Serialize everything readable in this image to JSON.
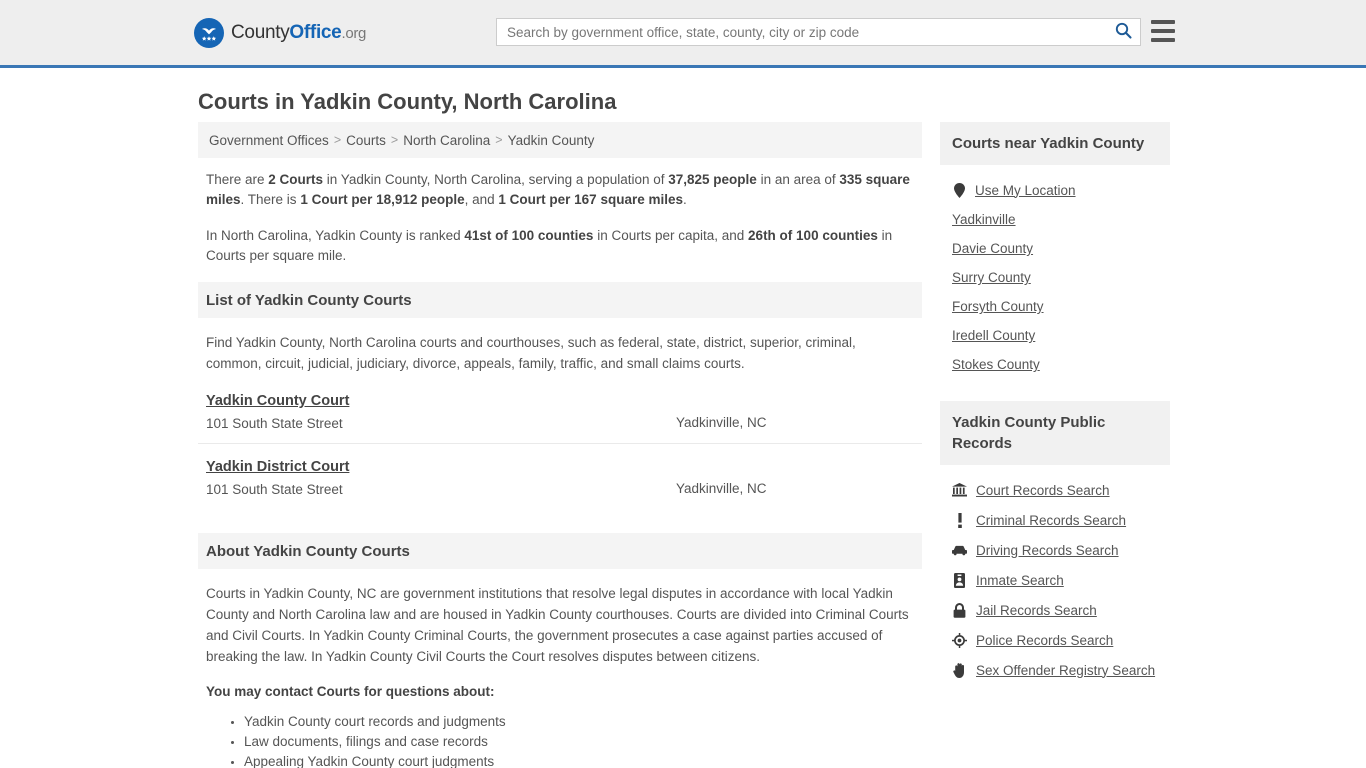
{
  "header": {
    "logo": {
      "icon": "eagle-shield-logo-icon",
      "text_county": "County",
      "text_office": "Office",
      "text_org": ".org"
    },
    "search": {
      "placeholder": "Search by government office, state, county, city or zip code",
      "value": "",
      "icon": "search-icon",
      "accent": "#1565b5"
    },
    "menu": {
      "icon": "hamburger-menu-icon"
    },
    "border_color": "#3a77b5",
    "background": "#eeeeee"
  },
  "page": {
    "title": "Courts in Yadkin County, North Carolina"
  },
  "breadcrumb": {
    "separator": ">",
    "items": [
      {
        "label": "Government Offices"
      },
      {
        "label": "Courts"
      },
      {
        "label": "North Carolina"
      },
      {
        "label": "Yadkin County"
      }
    ]
  },
  "intro": {
    "paragraph1": {
      "parts": [
        {
          "text": "There are ",
          "bold": false
        },
        {
          "text": "2 Courts",
          "bold": true
        },
        {
          "text": " in Yadkin County, North Carolina, serving a population of ",
          "bold": false
        },
        {
          "text": "37,825 people",
          "bold": true
        },
        {
          "text": " in an area of ",
          "bold": false
        },
        {
          "text": "335 square miles",
          "bold": true
        },
        {
          "text": ". There is ",
          "bold": false
        },
        {
          "text": "1 Court per 18,912 people",
          "bold": true
        },
        {
          "text": ", and ",
          "bold": false
        },
        {
          "text": "1 Court per 167 square miles",
          "bold": true
        },
        {
          "text": ".",
          "bold": false
        }
      ]
    },
    "paragraph2": {
      "parts": [
        {
          "text": "In North Carolina, Yadkin County is ranked ",
          "bold": false
        },
        {
          "text": "41st of 100 counties",
          "bold": true
        },
        {
          "text": " in Courts per capita, and ",
          "bold": false
        },
        {
          "text": "26th of 100 counties",
          "bold": true
        },
        {
          "text": " in Courts per square mile.",
          "bold": false
        }
      ]
    }
  },
  "list_section": {
    "heading": "List of Yadkin County Courts",
    "description": "Find Yadkin County, North Carolina courts and courthouses, such as federal, state, district, superior, criminal, common, circuit, judicial, judiciary, divorce, appeals, family, traffic, and small claims courts.",
    "courts": [
      {
        "name": "Yadkin County Court",
        "address": "101 South State Street",
        "city": "Yadkinville, NC"
      },
      {
        "name": "Yadkin District Court",
        "address": "101 South State Street",
        "city": "Yadkinville, NC"
      }
    ]
  },
  "about_section": {
    "heading": "About Yadkin County Courts",
    "body": "Courts in Yadkin County, NC are government institutions that resolve legal disputes in accordance with local Yadkin County and North Carolina law and are housed in Yadkin County courthouses. Courts are divided into Criminal Courts and Civil Courts. In Yadkin County Criminal Courts, the government prosecutes a case against parties accused of breaking the law. In Yadkin County Civil Courts the Court resolves disputes between citizens.",
    "contact_lead": "You may contact Courts for questions about:",
    "contact_items": [
      "Yadkin County court records and judgments",
      "Law documents, filings and case records",
      "Appealing Yadkin County court judgments"
    ]
  },
  "sidebar": {
    "nearby": {
      "heading": "Courts near Yadkin County",
      "items": [
        {
          "label": "Use My Location",
          "icon": "map-pin-icon"
        },
        {
          "label": "Yadkinville",
          "icon": ""
        },
        {
          "label": "Davie County",
          "icon": ""
        },
        {
          "label": "Surry County",
          "icon": ""
        },
        {
          "label": "Forsyth County",
          "icon": ""
        },
        {
          "label": "Iredell County",
          "icon": ""
        },
        {
          "label": "Stokes County",
          "icon": ""
        }
      ]
    },
    "public_records": {
      "heading": "Yadkin County Public Records",
      "items": [
        {
          "label": "Court Records Search",
          "icon": "courthouse-icon"
        },
        {
          "label": "Criminal Records Search",
          "icon": "exclamation-icon"
        },
        {
          "label": "Driving Records Search",
          "icon": "car-icon"
        },
        {
          "label": "Inmate Search",
          "icon": "id-badge-icon"
        },
        {
          "label": "Jail Records Search",
          "icon": "lock-icon"
        },
        {
          "label": "Police Records Search",
          "icon": "police-badge-icon"
        },
        {
          "label": "Sex Offender Registry Search",
          "icon": "hand-icon"
        }
      ]
    }
  }
}
